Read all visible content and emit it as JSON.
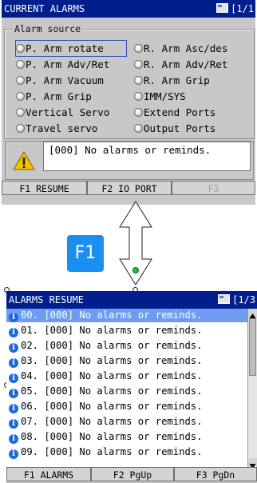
{
  "top": {
    "title": "CURRENT ALARMS",
    "page": "[1/1",
    "group_label": "Alarm source",
    "options_left": [
      "P. Arm rotate",
      "P. Arm Adv/Ret",
      "P. Arm Vacuum",
      "P. Arm Grip",
      "Vertical Servo",
      "Travel servo"
    ],
    "options_right": [
      "R. Arm Asc/des",
      "R. Arm Adv/Ret",
      "R. Arm Grip",
      "IMM/SYS",
      "Extend Ports",
      "Output Ports"
    ],
    "selected_option": "P. Arm rotate",
    "message": "[000] No alarms or reminds.",
    "fkeys": [
      "F1 RESUME",
      "F2 IO PORT",
      "F3"
    ]
  },
  "transition": {
    "badge": "F1"
  },
  "bottom": {
    "title": "ALARMS RESUME",
    "page": "[1/3",
    "rows": [
      "00. [000] No alarms or reminds.",
      "01. [000] No alarms or reminds.",
      "02. [000] No alarms or reminds.",
      "03. [000] No alarms or reminds.",
      "04. [000] No alarms or reminds.",
      "05. [000] No alarms or reminds.",
      "06. [000] No alarms or reminds.",
      "07. [000] No alarms or reminds.",
      "08. [000] No alarms or reminds.",
      "09. [000] No alarms or reminds."
    ],
    "selected_row": 0,
    "fkeys": [
      "F1 ALARMS",
      "F2 PgUp",
      "F3 PgDn"
    ]
  },
  "colors": {
    "titlebar": "#001e8c",
    "panel": "#c8c8c8",
    "selection": "#6d9cf0",
    "info_icon": "#1d69d8",
    "badge": "#1a8ff0",
    "warning": "#f2c400"
  },
  "icons": {
    "page": "window-icon",
    "warning": "warning-triangle-icon",
    "info": "info-icon",
    "arrow": "double-arrow-icon"
  }
}
